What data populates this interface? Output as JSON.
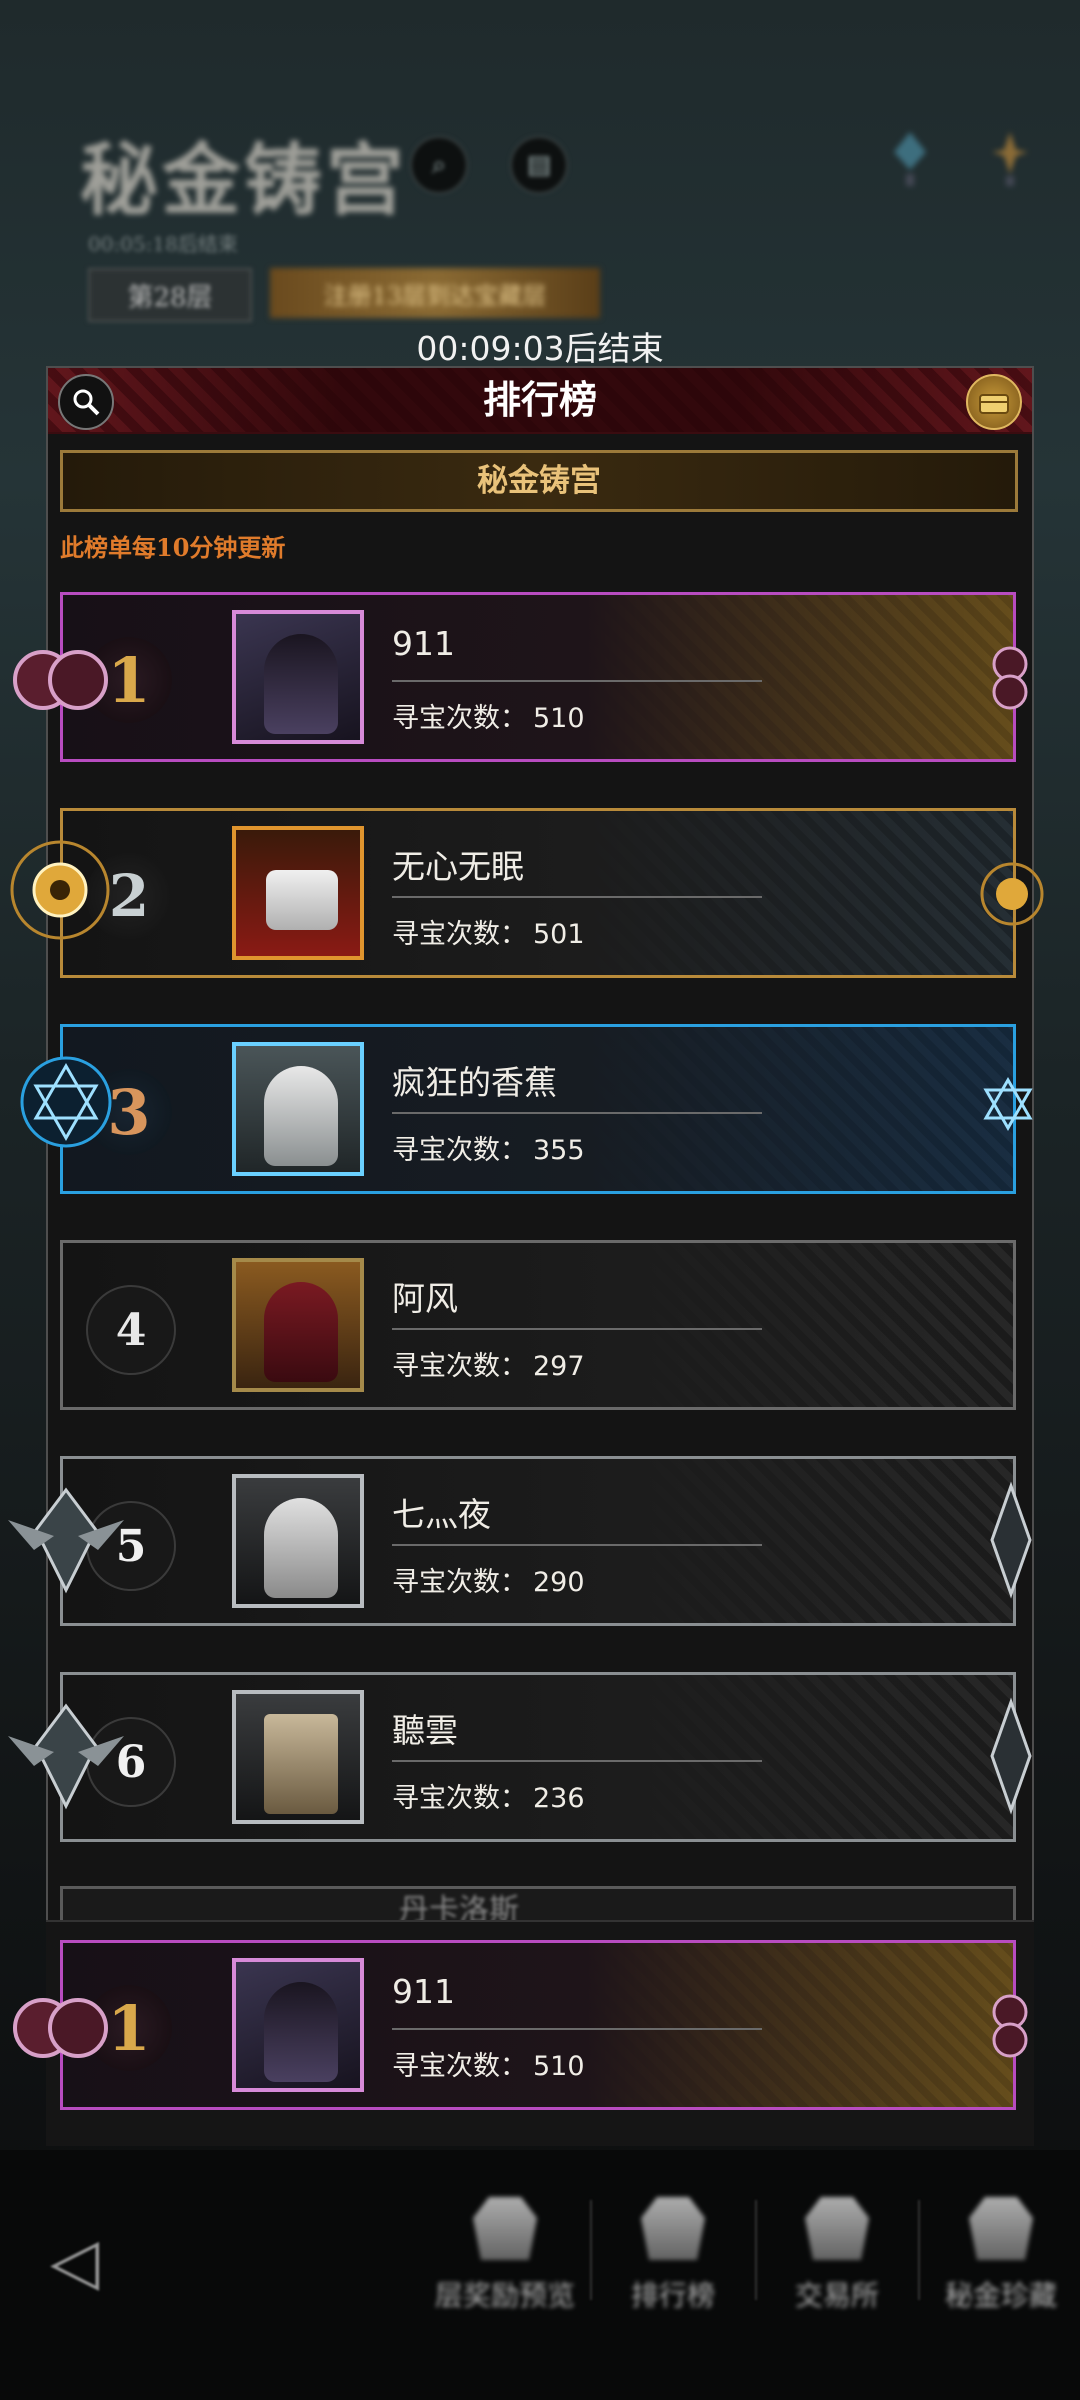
{
  "background": {
    "title": "秘金铸宫",
    "subtitle": "00:05:18后结束",
    "floor": "第28层",
    "banner": "注册13层到达宝藏层"
  },
  "timer": "00:09:03后结束",
  "panel": {
    "title": "排行榜",
    "subtitle": "秘金铸宫",
    "notice": "此榜单每10分钟更新"
  },
  "count_label": "寻宝次数：",
  "rankings": [
    {
      "rank": "1",
      "name": "911",
      "count": "510"
    },
    {
      "rank": "2",
      "name": "无心无眠",
      "count": "501"
    },
    {
      "rank": "3",
      "name": "疯狂的香蕉",
      "count": "355"
    },
    {
      "rank": "4",
      "name": "阿风",
      "count": "297"
    },
    {
      "rank": "5",
      "name": "七灬夜",
      "count": "290"
    },
    {
      "rank": "6",
      "name": "聽雲",
      "count": "236"
    }
  ],
  "partial_row_name": "丹卡洛斯",
  "my_rank": {
    "rank": "1",
    "name": "911",
    "count": "510"
  },
  "nav": {
    "back_icon": "back-arrow-icon",
    "items": [
      {
        "label": "层奖励预览",
        "icon": "reward-icon"
      },
      {
        "label": "排行榜",
        "icon": "trophy-icon"
      },
      {
        "label": "交易所",
        "icon": "exchange-icon"
      },
      {
        "label": "秘金珍藏",
        "icon": "treasure-icon"
      }
    ]
  },
  "colors": {
    "rank1": "#d9a84b",
    "rank2": "#c8d0d2",
    "rank3": "#d8955c",
    "notice": "#e07b2b",
    "header_red": "#6b1a20",
    "subtitle_gold": "#e9c27a"
  }
}
